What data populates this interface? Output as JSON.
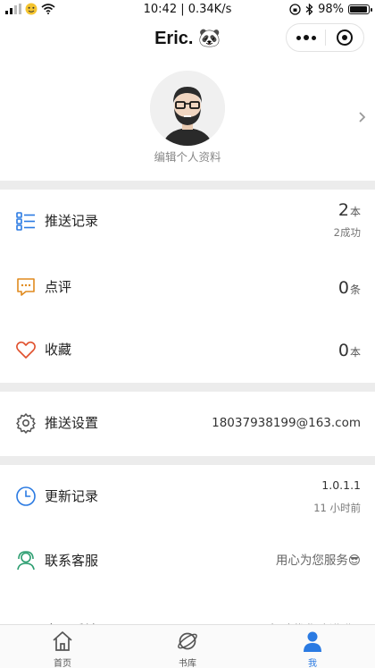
{
  "status_bar": {
    "time_speed": "10:42 | 0.34K/s",
    "battery": "98%",
    "battery_level": 0.98
  },
  "nav": {
    "title": "Eric. 🐼"
  },
  "profile": {
    "edit_label": "编辑个人资料"
  },
  "rows": {
    "push_records": {
      "label": "推送记录",
      "count": "2",
      "unit": "本",
      "sub": "2成功",
      "icon": "list-icon"
    },
    "comments": {
      "label": "点评",
      "count": "0",
      "unit": "条",
      "icon": "chat-icon"
    },
    "favorites": {
      "label": "收藏",
      "count": "0",
      "unit": "本",
      "icon": "heart-icon"
    },
    "push_settings": {
      "label": "推送设置",
      "value": "18037938199@163.com",
      "icon": "gear-icon"
    },
    "update_log": {
      "label": "更新记录",
      "version": "1.0.1.1",
      "time": "11 小时前",
      "icon": "clock-icon"
    },
    "customer_service": {
      "label": "联系客服",
      "value": "用心为您服务😎",
      "icon": "headset-icon"
    },
    "feedback": {
      "label": "意见反馈",
      "value": "帮助优化改进哟.."
    }
  },
  "tabs": [
    {
      "label": "首页",
      "icon": "home-icon",
      "active": false
    },
    {
      "label": "书库",
      "icon": "planet-icon",
      "active": false
    },
    {
      "label": "我",
      "icon": "user-icon",
      "active": true
    }
  ],
  "colors": {
    "accent_blue": "#2a7ae2",
    "orange": "#e08a1e",
    "red": "#e0502d",
    "gap_gray": "#ececec"
  }
}
